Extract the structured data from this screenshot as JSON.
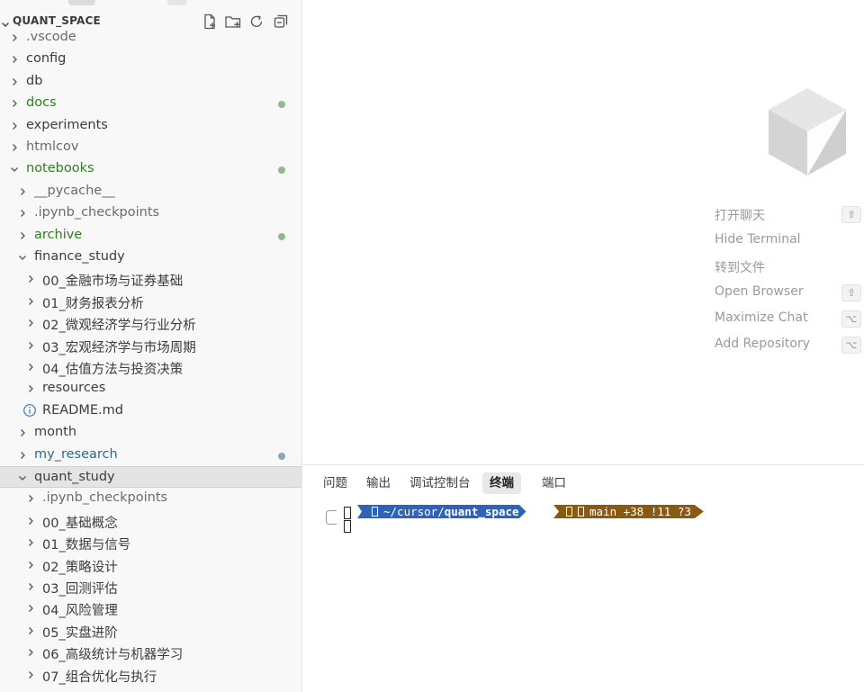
{
  "explorer": {
    "title": "QUANT_SPACE",
    "header_icons": [
      "new-file-icon",
      "new-folder-icon",
      "refresh-icon",
      "collapse-all-icon"
    ]
  },
  "tree": [
    {
      "label": ".vscode",
      "depth": 0,
      "type": "folder",
      "expanded": false,
      "color": "muted",
      "dot": false
    },
    {
      "label": "config",
      "depth": 0,
      "type": "folder",
      "expanded": false,
      "color": "normal",
      "dot": false
    },
    {
      "label": "db",
      "depth": 0,
      "type": "folder",
      "expanded": false,
      "color": "normal",
      "dot": false
    },
    {
      "label": "docs",
      "depth": 0,
      "type": "folder",
      "expanded": false,
      "color": "green",
      "dot": true
    },
    {
      "label": "experiments",
      "depth": 0,
      "type": "folder",
      "expanded": false,
      "color": "normal",
      "dot": false
    },
    {
      "label": "htmlcov",
      "depth": 0,
      "type": "folder",
      "expanded": false,
      "color": "muted",
      "dot": false
    },
    {
      "label": "notebooks",
      "depth": 0,
      "type": "folder",
      "expanded": true,
      "color": "green",
      "dot": true
    },
    {
      "label": "__pycache__",
      "depth": 1,
      "type": "folder",
      "expanded": false,
      "color": "muted",
      "dot": false
    },
    {
      "label": ".ipynb_checkpoints",
      "depth": 1,
      "type": "folder",
      "expanded": false,
      "color": "muted",
      "dot": false
    },
    {
      "label": "archive",
      "depth": 1,
      "type": "folder",
      "expanded": false,
      "color": "green",
      "dot": true
    },
    {
      "label": "finance_study",
      "depth": 1,
      "type": "folder",
      "expanded": true,
      "color": "normal",
      "dot": false
    },
    {
      "label": "00_金融市场与证券基础",
      "depth": 2,
      "type": "folder",
      "expanded": false,
      "color": "normal",
      "dot": false
    },
    {
      "label": "01_财务报表分析",
      "depth": 2,
      "type": "folder",
      "expanded": false,
      "color": "normal",
      "dot": false
    },
    {
      "label": "02_微观经济学与行业分析",
      "depth": 2,
      "type": "folder",
      "expanded": false,
      "color": "normal",
      "dot": false
    },
    {
      "label": "03_宏观经济学与市场周期",
      "depth": 2,
      "type": "folder",
      "expanded": false,
      "color": "normal",
      "dot": false
    },
    {
      "label": "04_估值方法与投资决策",
      "depth": 2,
      "type": "folder",
      "expanded": false,
      "color": "normal",
      "dot": false
    },
    {
      "label": "resources",
      "depth": 2,
      "type": "folder",
      "expanded": false,
      "color": "normal",
      "dot": false
    },
    {
      "label": "README.md",
      "depth": 2,
      "type": "file",
      "icon": "info-icon",
      "color": "normal",
      "dot": false
    },
    {
      "label": "month",
      "depth": 1,
      "type": "folder",
      "expanded": false,
      "color": "normal",
      "dot": false
    },
    {
      "label": "my_research",
      "depth": 1,
      "type": "folder",
      "expanded": false,
      "color": "teal",
      "dot": true,
      "dot_color": "blue"
    },
    {
      "label": "quant_study",
      "depth": 1,
      "type": "folder",
      "expanded": true,
      "color": "normal",
      "dot": false,
      "selected": true
    },
    {
      "label": ".ipynb_checkpoints",
      "depth": 2,
      "type": "folder",
      "expanded": false,
      "color": "muted",
      "dot": false
    },
    {
      "label": "00_基础概念",
      "depth": 2,
      "type": "folder",
      "expanded": false,
      "color": "normal",
      "dot": false
    },
    {
      "label": "01_数据与信号",
      "depth": 2,
      "type": "folder",
      "expanded": false,
      "color": "normal",
      "dot": false
    },
    {
      "label": "02_策略设计",
      "depth": 2,
      "type": "folder",
      "expanded": false,
      "color": "normal",
      "dot": false
    },
    {
      "label": "03_回测评估",
      "depth": 2,
      "type": "folder",
      "expanded": false,
      "color": "normal",
      "dot": false
    },
    {
      "label": "04_风险管理",
      "depth": 2,
      "type": "folder",
      "expanded": false,
      "color": "normal",
      "dot": false
    },
    {
      "label": "05_实盘进阶",
      "depth": 2,
      "type": "folder",
      "expanded": false,
      "color": "normal",
      "dot": false
    },
    {
      "label": "06_高级统计与机器学习",
      "depth": 2,
      "type": "folder",
      "expanded": false,
      "color": "normal",
      "dot": false
    },
    {
      "label": "07_组合优化与执行",
      "depth": 2,
      "type": "folder",
      "expanded": false,
      "color": "normal",
      "dot": false
    }
  ],
  "editor": {
    "logo_icon": "cursor-cube-icon",
    "hints": [
      {
        "label": "打开聊天",
        "key": "⇧"
      },
      {
        "label": "Hide Terminal",
        "key": ""
      },
      {
        "label": "转到文件",
        "key": ""
      },
      {
        "label": "Open Browser",
        "key": "⇧"
      },
      {
        "label": "Maximize Chat",
        "key": "⌥"
      },
      {
        "label": "Add Repository",
        "key": "⌥"
      }
    ]
  },
  "panel": {
    "tabs": [
      {
        "label": "问题",
        "active": false
      },
      {
        "label": "输出",
        "active": false
      },
      {
        "label": "调试控制台",
        "active": false
      },
      {
        "label": "终端",
        "active": true
      },
      {
        "label": "端口",
        "active": false
      }
    ],
    "terminal": {
      "path_prefix": "~/cursor/",
      "path_bold": "quant_space",
      "git_status": "main +38 !11 ?3",
      "colors": {
        "dir_segment": "#2f63b8",
        "git_segment": "#8a5a12"
      }
    }
  }
}
